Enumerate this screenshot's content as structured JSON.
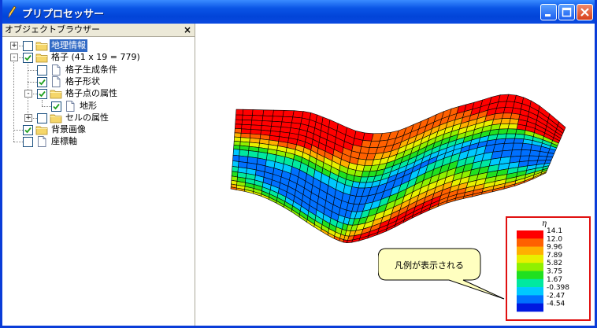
{
  "window": {
    "title": "プリプロセッサー"
  },
  "browser": {
    "title": "オブジェクトブラウザー",
    "close_glyph": "×",
    "items": [
      {
        "label": "地理情報",
        "checked": false,
        "icon": "folder-icon",
        "expander": "+"
      },
      {
        "label": "格子 (41 x 19 = 779)",
        "checked": true,
        "icon": "folder-icon",
        "expander": "-"
      },
      {
        "label": "格子生成条件",
        "checked": false,
        "icon": "document-icon"
      },
      {
        "label": "格子形状",
        "checked": true,
        "icon": "document-icon"
      },
      {
        "label": "格子点の属性",
        "checked": true,
        "icon": "folder-icon",
        "expander": "-"
      },
      {
        "label": "地形",
        "checked": true,
        "icon": "document-icon"
      },
      {
        "label": "セルの属性",
        "checked": false,
        "icon": "folder-icon",
        "expander": "+"
      },
      {
        "label": "背景画像",
        "checked": true,
        "icon": "folder-icon"
      },
      {
        "label": "座標軸",
        "checked": false,
        "icon": "document-icon"
      }
    ]
  },
  "legend": {
    "title": "η",
    "values": [
      "14.1",
      "12.0",
      "9.96",
      "7.89",
      "5.82",
      "3.75",
      "1.67",
      "-0.398",
      "-2.47",
      "-4.54"
    ],
    "colors": [
      "#ff0000",
      "#ff6000",
      "#ffb000",
      "#e8f000",
      "#90f000",
      "#20e020",
      "#00e8a0",
      "#00c8ff",
      "#0070ff",
      "#0018e0"
    ]
  },
  "callout": {
    "text": "凡例が表示される"
  },
  "colors": {
    "titlebar": "#0a55e6",
    "selection": "#316ac5",
    "legend_border": "#e01010",
    "callout_fill": "#ffffc0"
  }
}
